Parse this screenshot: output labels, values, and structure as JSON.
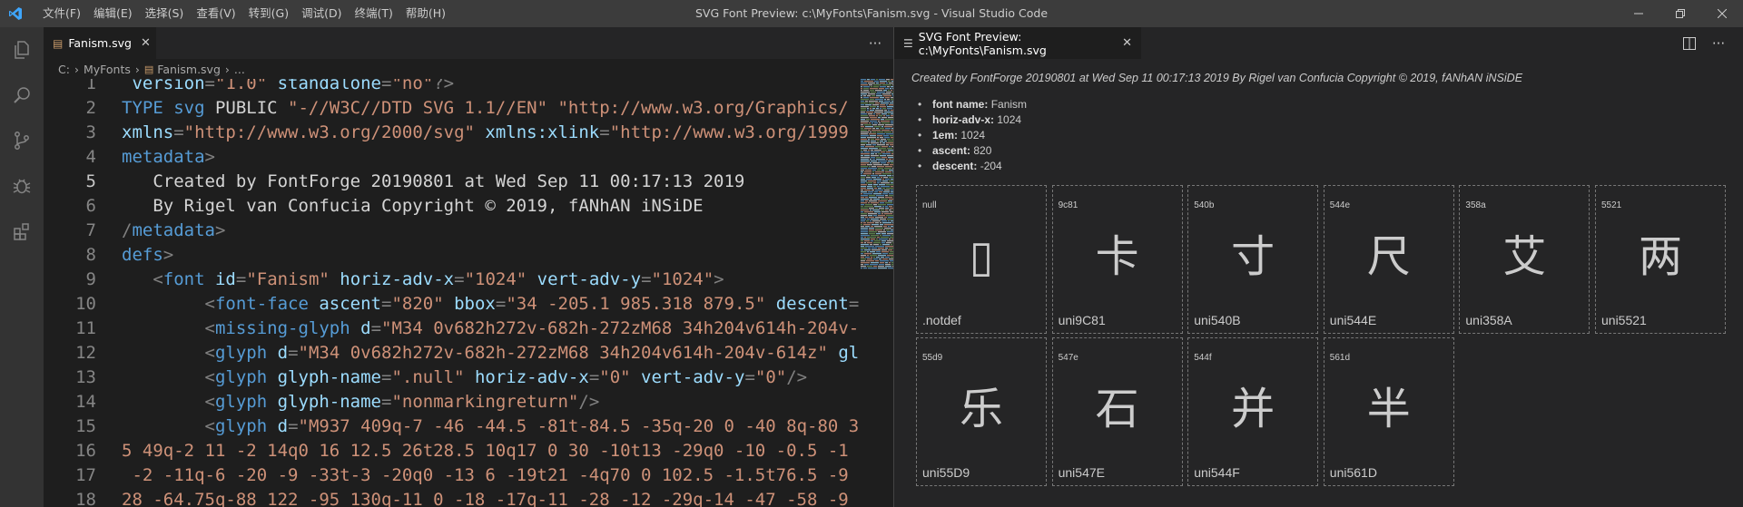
{
  "menu": [
    "文件(F)",
    "编辑(E)",
    "选择(S)",
    "查看(V)",
    "转到(G)",
    "调试(D)",
    "终端(T)",
    "帮助(H)"
  ],
  "window_title": "SVG Font Preview: c:\\MyFonts\\Fanism.svg - Visual Studio Code",
  "activity_icons": [
    "files-icon",
    "search-icon",
    "source-control-icon",
    "debug-icon",
    "extensions-icon"
  ],
  "editor": {
    "tab_label": "Fanism.svg",
    "more_label": "···",
    "breadcrumb": {
      "root": "C:",
      "folder": "MyFonts",
      "file": "Fanism.svg",
      "tail": "..."
    },
    "lines": [
      {
        "n": "1",
        "segs": [
          [
            "c-attr",
            " version"
          ],
          [
            "c-pun",
            "="
          ],
          [
            "c-str",
            "\"1.0\""
          ],
          [
            "c-attr",
            " standalone"
          ],
          [
            "c-pun",
            "="
          ],
          [
            "c-str",
            "\"no\""
          ],
          [
            "c-pun",
            "?>"
          ]
        ]
      },
      {
        "n": "2",
        "segs": [
          [
            "c-tag",
            "TYPE svg"
          ],
          [
            "c-txt",
            " PUBLIC "
          ],
          [
            "c-str",
            "\"-//W3C//DTD SVG 1.1//EN\" "
          ],
          [
            "c-str",
            "\"http://www.w3.org/Graphics/"
          ]
        ]
      },
      {
        "n": "3",
        "segs": [
          [
            "c-attr",
            "xmlns"
          ],
          [
            "c-pun",
            "="
          ],
          [
            "c-str",
            "\"http://www.w3.org/2000/svg\""
          ],
          [
            "c-attr",
            " xmlns:xlink"
          ],
          [
            "c-pun",
            "="
          ],
          [
            "c-str",
            "\"http://www.w3.org/1999"
          ]
        ]
      },
      {
        "n": "4",
        "segs": [
          [
            "c-tag",
            "metadata"
          ],
          [
            "c-pun",
            ">"
          ]
        ]
      },
      {
        "n": "5",
        "segs": [
          [
            "c-txt",
            "   Created by FontForge 20190801 at Wed Sep 11 00:17:13 2019"
          ]
        ]
      },
      {
        "n": "6",
        "segs": [
          [
            "c-txt",
            "   By Rigel van Confucia Copyright © 2019, fANhAN iNSiDE"
          ]
        ]
      },
      {
        "n": "7",
        "segs": [
          [
            "c-pun",
            "/"
          ],
          [
            "c-tag",
            "metadata"
          ],
          [
            "c-pun",
            ">"
          ]
        ]
      },
      {
        "n": "8",
        "segs": [
          [
            "c-tag",
            "defs"
          ],
          [
            "c-pun",
            ">"
          ]
        ]
      },
      {
        "n": "9",
        "segs": [
          [
            "c-txt",
            "   "
          ],
          [
            "c-pun",
            "<"
          ],
          [
            "c-tag",
            "font"
          ],
          [
            "c-attr",
            " id"
          ],
          [
            "c-pun",
            "="
          ],
          [
            "c-str",
            "\"Fanism\""
          ],
          [
            "c-attr",
            " horiz-adv-x"
          ],
          [
            "c-pun",
            "="
          ],
          [
            "c-str",
            "\"1024\""
          ],
          [
            "c-attr",
            " vert-adv-y"
          ],
          [
            "c-pun",
            "="
          ],
          [
            "c-str",
            "\"1024\""
          ],
          [
            "c-pun",
            ">"
          ]
        ]
      },
      {
        "n": "10",
        "segs": [
          [
            "c-txt",
            "        "
          ],
          [
            "c-pun",
            "<"
          ],
          [
            "c-tag",
            "font-face"
          ],
          [
            "c-attr",
            " ascent"
          ],
          [
            "c-pun",
            "="
          ],
          [
            "c-str",
            "\"820\""
          ],
          [
            "c-attr",
            " bbox"
          ],
          [
            "c-pun",
            "="
          ],
          [
            "c-str",
            "\"34 -205.1 985.318 879.5\""
          ],
          [
            "c-attr",
            " descent"
          ],
          [
            "c-pun",
            "="
          ]
        ]
      },
      {
        "n": "11",
        "segs": [
          [
            "c-txt",
            "        "
          ],
          [
            "c-pun",
            "<"
          ],
          [
            "c-tag",
            "missing-glyph"
          ],
          [
            "c-attr",
            " d"
          ],
          [
            "c-pun",
            "="
          ],
          [
            "c-str",
            "\"M34 0v682h272v-682h-272zM68 34h204v614h-204v-"
          ]
        ]
      },
      {
        "n": "12",
        "segs": [
          [
            "c-txt",
            "        "
          ],
          [
            "c-pun",
            "<"
          ],
          [
            "c-tag",
            "glyph"
          ],
          [
            "c-attr",
            " d"
          ],
          [
            "c-pun",
            "="
          ],
          [
            "c-str",
            "\"M34 0v682h272v-682h-272zM68 34h204v614h-204v-614z\""
          ],
          [
            "c-attr",
            " gl"
          ]
        ]
      },
      {
        "n": "13",
        "segs": [
          [
            "c-txt",
            "        "
          ],
          [
            "c-pun",
            "<"
          ],
          [
            "c-tag",
            "glyph"
          ],
          [
            "c-attr",
            " glyph-name"
          ],
          [
            "c-pun",
            "="
          ],
          [
            "c-str",
            "\".null\""
          ],
          [
            "c-attr",
            " horiz-adv-x"
          ],
          [
            "c-pun",
            "="
          ],
          [
            "c-str",
            "\"0\""
          ],
          [
            "c-attr",
            " vert-adv-y"
          ],
          [
            "c-pun",
            "="
          ],
          [
            "c-str",
            "\"0\""
          ],
          [
            "c-pun",
            "/>"
          ]
        ]
      },
      {
        "n": "14",
        "segs": [
          [
            "c-txt",
            "        "
          ],
          [
            "c-pun",
            "<"
          ],
          [
            "c-tag",
            "glyph"
          ],
          [
            "c-attr",
            " glyph-name"
          ],
          [
            "c-pun",
            "="
          ],
          [
            "c-str",
            "\"nonmarkingreturn\""
          ],
          [
            "c-pun",
            "/>"
          ]
        ]
      },
      {
        "n": "15",
        "segs": [
          [
            "c-txt",
            "        "
          ],
          [
            "c-pun",
            "<"
          ],
          [
            "c-tag",
            "glyph"
          ],
          [
            "c-attr",
            " d"
          ],
          [
            "c-pun",
            "="
          ],
          [
            "c-str",
            "\"M937 409q-7 -46 -44.5 -81t-84.5 -35q-20 0 -40 8q-80 3"
          ]
        ]
      },
      {
        "n": "16",
        "segs": [
          [
            "c-str",
            "5 49q-2 11 -2 14q0 16 12.5 26t28.5 10q17 0 30 -10t13 -29q0 -10 -0.5 -1"
          ]
        ]
      },
      {
        "n": "17",
        "segs": [
          [
            "c-str",
            " -2 -11q-6 -20 -9 -33t-3 -20q0 -13 6 -19t21 -4q70 0 102.5 -1.5t76.5 -9"
          ]
        ]
      },
      {
        "n": "18",
        "segs": [
          [
            "c-str",
            "28 -64.75q-88 122 -95 130q-11 0 -18 -17q-11 -28 -12 -29q-14 -47 -58 -9"
          ]
        ]
      }
    ]
  },
  "preview": {
    "tab_label": "SVG Font Preview: c:\\MyFonts\\Fanism.svg",
    "credit": "Created by FontForge 20190801 at Wed Sep 11 00:17:13 2019 By Rigel van Confucia Copyright © 2019, fANhAN iNSiDE",
    "props": [
      {
        "key": "font name:",
        "val": "Fanism"
      },
      {
        "key": "horiz-adv-x:",
        "val": "1024"
      },
      {
        "key": "1em:",
        "val": "1024"
      },
      {
        "key": "ascent:",
        "val": "820"
      },
      {
        "key": "descent:",
        "val": "-204"
      }
    ],
    "glyphs": [
      {
        "code": "null",
        "char": "▯",
        "name": ".notdef"
      },
      {
        "code": "9c81",
        "char": "卡",
        "name": "uni9C81"
      },
      {
        "code": "540b",
        "char": "寸",
        "name": "uni540B"
      },
      {
        "code": "544e",
        "char": "尺",
        "name": "uni544E"
      },
      {
        "code": "358a",
        "char": "艾",
        "name": "uni358A"
      },
      {
        "code": "5521",
        "char": "两",
        "name": "uni5521"
      },
      {
        "code": "55d9",
        "char": "乐",
        "name": "uni55D9"
      },
      {
        "code": "547e",
        "char": "石",
        "name": "uni547E"
      },
      {
        "code": "544f",
        "char": "并",
        "name": "uni544F"
      },
      {
        "code": "561d",
        "char": "半",
        "name": "uni561D"
      }
    ]
  },
  "colors": {
    "accent": "#0078d4",
    "tag": "#569cd6",
    "attr": "#9cdcfe",
    "string": "#ce9178"
  }
}
